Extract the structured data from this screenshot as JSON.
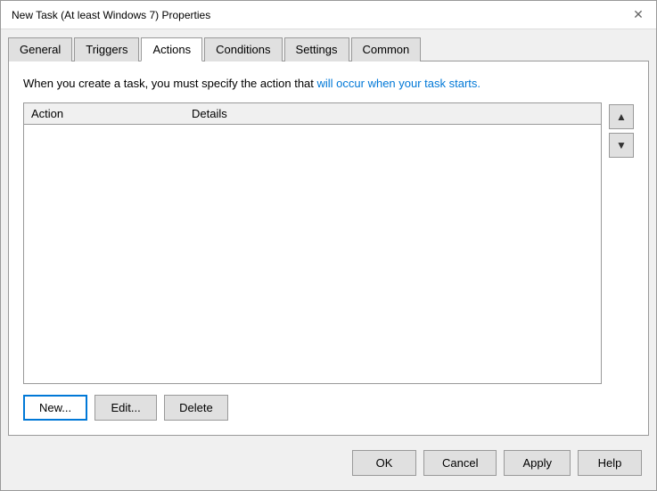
{
  "window": {
    "title": "New Task (At least Windows 7) Properties",
    "close_label": "✕"
  },
  "tabs": [
    {
      "id": "general",
      "label": "General",
      "active": false
    },
    {
      "id": "triggers",
      "label": "Triggers",
      "active": false
    },
    {
      "id": "actions",
      "label": "Actions",
      "active": true
    },
    {
      "id": "conditions",
      "label": "Conditions",
      "active": false
    },
    {
      "id": "settings",
      "label": "Settings",
      "active": false
    },
    {
      "id": "common",
      "label": "Common",
      "active": false
    }
  ],
  "content": {
    "description": "When you create a task, you must specify the action that will occur when your task starts.",
    "table": {
      "col_action": "Action",
      "col_details": "Details",
      "rows": []
    },
    "buttons": {
      "new_label": "New...",
      "edit_label": "Edit...",
      "delete_label": "Delete"
    },
    "arrow_up": "▲",
    "arrow_down": "▼"
  },
  "footer": {
    "ok_label": "OK",
    "cancel_label": "Cancel",
    "apply_label": "Apply",
    "help_label": "Help"
  }
}
